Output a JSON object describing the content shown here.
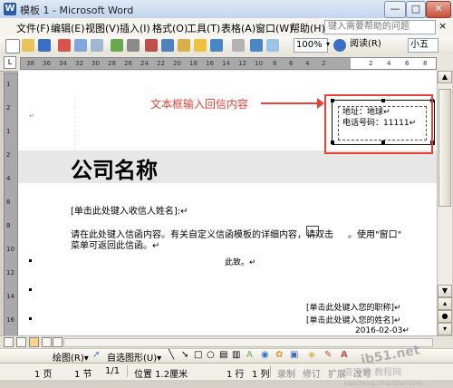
{
  "window": {
    "title": "模板 1 - Microsoft Word",
    "app_icon": "W",
    "min_label": "—",
    "max_label": "□",
    "close_label": "✕"
  },
  "menu": {
    "items": [
      "文件(F)",
      "编辑(E)",
      "视图(V)",
      "插入(I)",
      "格式(O)",
      "工具(T)",
      "表格(A)",
      "窗口(W)",
      "帮助(H)"
    ],
    "help_placeholder": "键入需要帮助的问题",
    "close_doc": "×"
  },
  "toolbar": {
    "zoom": "100%",
    "reading_label": "阅读(R)",
    "font_size": "小五"
  },
  "ruler": {
    "ticks": [
      "38",
      "36",
      "34",
      "32",
      "30",
      "28",
      "26",
      "24",
      "22",
      "20",
      "18",
      "16",
      "14",
      "12",
      "10",
      "8",
      "6",
      "4",
      "2",
      "",
      "2",
      "4",
      "6",
      "8"
    ],
    "left_ticks": [
      "1",
      "2",
      "1",
      "2",
      "4",
      "6",
      "8",
      "10",
      "12",
      "14",
      "16"
    ]
  },
  "document": {
    "company_name": "公司名称",
    "recipient": "[单击此处键入收信人姓名]:↵",
    "body_line1": "请在此处键入信函内容。有关自定义信函模板的详细内容，请双击",
    "body_line1_tail": "。使用\"窗口\"",
    "body_line2": "菜单可返回此信函。↵",
    "closing": "此致。↵",
    "title_field": "[单击此处键入您的职称]↵",
    "name_field": "[单击此处键入您的姓名]↵",
    "date_field": "2016-02-03↵"
  },
  "textbox": {
    "address": "地址：地球↵",
    "phone": "电话号码：11111↵"
  },
  "annotation": {
    "text": "文本框输入回信内容",
    "color": "#e8413a"
  },
  "drawing_toolbar": {
    "draw_label": "绘图(R)▾",
    "autoshape_label": "自选图形(U)▾"
  },
  "status": {
    "page": "1 页",
    "section": "1 节",
    "page_of": "1/1",
    "position": "位置 1.2厘米",
    "line": "1 行",
    "column": "1 列",
    "rec": "录制",
    "trk": "修订",
    "ext": "扩展",
    "ovr": "改写"
  },
  "watermark": {
    "site": "jb51.net",
    "label": "查字典 教程网",
    "url": "jiaocheng.chazidian.com"
  }
}
